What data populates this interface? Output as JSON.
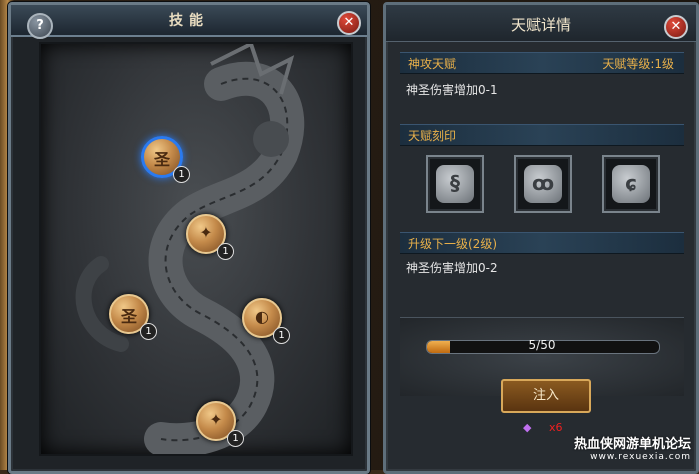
{
  "skill_panel": {
    "title": "技能",
    "help_label": "?",
    "close_label": "✕",
    "nodes": [
      {
        "glyph": "圣",
        "level": "1",
        "selected": true
      },
      {
        "glyph": "✦",
        "level": "1",
        "selected": false
      },
      {
        "glyph": "圣",
        "level": "1",
        "selected": false
      },
      {
        "glyph": "◐",
        "level": "1",
        "selected": false
      },
      {
        "glyph": "✦",
        "level": "1",
        "selected": false
      }
    ]
  },
  "detail_panel": {
    "title": "天赋详情",
    "close_label": "✕",
    "talent_name": "神攻天赋",
    "talent_level": "天赋等级:1级",
    "current_effect": "神圣伤害增加0-1",
    "imprint_label": "天赋刻印",
    "runes": [
      "§",
      "ꝏ",
      "ɕ"
    ],
    "next_level_label": "升级下一级(2级)",
    "next_effect": "神圣伤害增加0-2",
    "progress": {
      "text": "5/50",
      "current": 5,
      "max": 50
    },
    "inject_label": "注入",
    "item_icon": "crystal-icon",
    "item_count": "x6"
  },
  "watermark": {
    "line1": "热血侠网游单机论坛",
    "line2": "www.rexuexia.com"
  }
}
